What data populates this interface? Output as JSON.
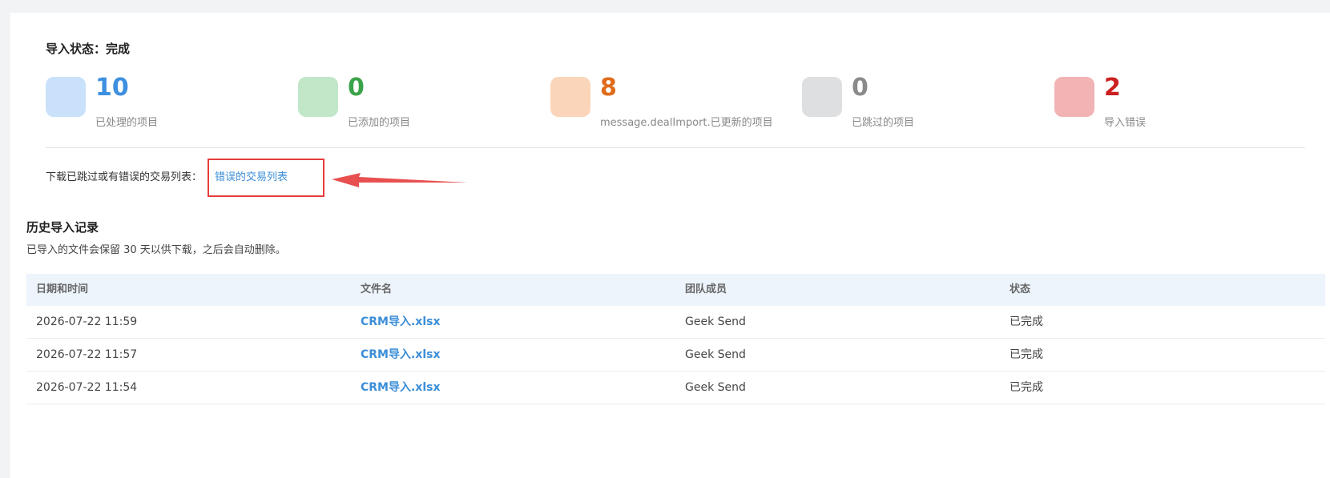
{
  "import_status": {
    "title": "导入状态：完成"
  },
  "stats": [
    {
      "value": "10",
      "label": "已处理的项目",
      "color": "#3d8fe0",
      "box_color": "#c9e1fb"
    },
    {
      "value": "0",
      "label": "已添加的项目",
      "color": "#3aa34a",
      "box_color": "#c1e7c8"
    },
    {
      "value": "8",
      "label": "message.dealImport.已更新的项目",
      "color": "#e06b1a",
      "box_color": "#fad5b9"
    },
    {
      "value": "0",
      "label": "已跳过的项目",
      "color": "#8a8a8a",
      "box_color": "#dedfe0"
    },
    {
      "value": "2",
      "label": "导入错误",
      "color": "#cc1f1f",
      "box_color": "#f1b3b3"
    }
  ],
  "download": {
    "prefix": "下载已跳过或有错误的交易列表：",
    "link": "错误的交易列表"
  },
  "history": {
    "title": "历史导入记录",
    "note": "已导入的文件会保留 30 天以供下载，之后会自动删除。",
    "columns": [
      "日期和时间",
      "文件名",
      "团队成员",
      "状态"
    ],
    "rows": [
      {
        "datetime": "2026-07-22 11:59",
        "filename": "CRM导入.xlsx",
        "member": "Geek Send",
        "status": "已完成"
      },
      {
        "datetime": "2026-07-22 11:57",
        "filename": "CRM导入.xlsx",
        "member": "Geek Send",
        "status": "已完成"
      },
      {
        "datetime": "2026-07-22 11:54",
        "filename": "CRM导入.xlsx",
        "member": "Geek Send",
        "status": "已完成"
      }
    ]
  },
  "annotation": {
    "highlight_color": "#e63c3c"
  }
}
